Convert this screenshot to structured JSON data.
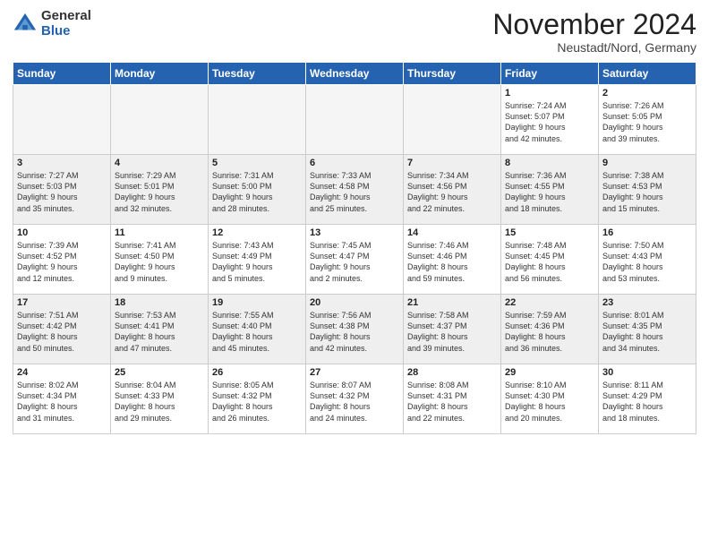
{
  "logo": {
    "general": "General",
    "blue": "Blue"
  },
  "header": {
    "month": "November 2024",
    "location": "Neustadt/Nord, Germany"
  },
  "weekdays": [
    "Sunday",
    "Monday",
    "Tuesday",
    "Wednesday",
    "Thursday",
    "Friday",
    "Saturday"
  ],
  "weeks": [
    [
      {
        "day": "",
        "info": ""
      },
      {
        "day": "",
        "info": ""
      },
      {
        "day": "",
        "info": ""
      },
      {
        "day": "",
        "info": ""
      },
      {
        "day": "",
        "info": ""
      },
      {
        "day": "1",
        "info": "Sunrise: 7:24 AM\nSunset: 5:07 PM\nDaylight: 9 hours\nand 42 minutes."
      },
      {
        "day": "2",
        "info": "Sunrise: 7:26 AM\nSunset: 5:05 PM\nDaylight: 9 hours\nand 39 minutes."
      }
    ],
    [
      {
        "day": "3",
        "info": "Sunrise: 7:27 AM\nSunset: 5:03 PM\nDaylight: 9 hours\nand 35 minutes."
      },
      {
        "day": "4",
        "info": "Sunrise: 7:29 AM\nSunset: 5:01 PM\nDaylight: 9 hours\nand 32 minutes."
      },
      {
        "day": "5",
        "info": "Sunrise: 7:31 AM\nSunset: 5:00 PM\nDaylight: 9 hours\nand 28 minutes."
      },
      {
        "day": "6",
        "info": "Sunrise: 7:33 AM\nSunset: 4:58 PM\nDaylight: 9 hours\nand 25 minutes."
      },
      {
        "day": "7",
        "info": "Sunrise: 7:34 AM\nSunset: 4:56 PM\nDaylight: 9 hours\nand 22 minutes."
      },
      {
        "day": "8",
        "info": "Sunrise: 7:36 AM\nSunset: 4:55 PM\nDaylight: 9 hours\nand 18 minutes."
      },
      {
        "day": "9",
        "info": "Sunrise: 7:38 AM\nSunset: 4:53 PM\nDaylight: 9 hours\nand 15 minutes."
      }
    ],
    [
      {
        "day": "10",
        "info": "Sunrise: 7:39 AM\nSunset: 4:52 PM\nDaylight: 9 hours\nand 12 minutes."
      },
      {
        "day": "11",
        "info": "Sunrise: 7:41 AM\nSunset: 4:50 PM\nDaylight: 9 hours\nand 9 minutes."
      },
      {
        "day": "12",
        "info": "Sunrise: 7:43 AM\nSunset: 4:49 PM\nDaylight: 9 hours\nand 5 minutes."
      },
      {
        "day": "13",
        "info": "Sunrise: 7:45 AM\nSunset: 4:47 PM\nDaylight: 9 hours\nand 2 minutes."
      },
      {
        "day": "14",
        "info": "Sunrise: 7:46 AM\nSunset: 4:46 PM\nDaylight: 8 hours\nand 59 minutes."
      },
      {
        "day": "15",
        "info": "Sunrise: 7:48 AM\nSunset: 4:45 PM\nDaylight: 8 hours\nand 56 minutes."
      },
      {
        "day": "16",
        "info": "Sunrise: 7:50 AM\nSunset: 4:43 PM\nDaylight: 8 hours\nand 53 minutes."
      }
    ],
    [
      {
        "day": "17",
        "info": "Sunrise: 7:51 AM\nSunset: 4:42 PM\nDaylight: 8 hours\nand 50 minutes."
      },
      {
        "day": "18",
        "info": "Sunrise: 7:53 AM\nSunset: 4:41 PM\nDaylight: 8 hours\nand 47 minutes."
      },
      {
        "day": "19",
        "info": "Sunrise: 7:55 AM\nSunset: 4:40 PM\nDaylight: 8 hours\nand 45 minutes."
      },
      {
        "day": "20",
        "info": "Sunrise: 7:56 AM\nSunset: 4:38 PM\nDaylight: 8 hours\nand 42 minutes."
      },
      {
        "day": "21",
        "info": "Sunrise: 7:58 AM\nSunset: 4:37 PM\nDaylight: 8 hours\nand 39 minutes."
      },
      {
        "day": "22",
        "info": "Sunrise: 7:59 AM\nSunset: 4:36 PM\nDaylight: 8 hours\nand 36 minutes."
      },
      {
        "day": "23",
        "info": "Sunrise: 8:01 AM\nSunset: 4:35 PM\nDaylight: 8 hours\nand 34 minutes."
      }
    ],
    [
      {
        "day": "24",
        "info": "Sunrise: 8:02 AM\nSunset: 4:34 PM\nDaylight: 8 hours\nand 31 minutes."
      },
      {
        "day": "25",
        "info": "Sunrise: 8:04 AM\nSunset: 4:33 PM\nDaylight: 8 hours\nand 29 minutes."
      },
      {
        "day": "26",
        "info": "Sunrise: 8:05 AM\nSunset: 4:32 PM\nDaylight: 8 hours\nand 26 minutes."
      },
      {
        "day": "27",
        "info": "Sunrise: 8:07 AM\nSunset: 4:32 PM\nDaylight: 8 hours\nand 24 minutes."
      },
      {
        "day": "28",
        "info": "Sunrise: 8:08 AM\nSunset: 4:31 PM\nDaylight: 8 hours\nand 22 minutes."
      },
      {
        "day": "29",
        "info": "Sunrise: 8:10 AM\nSunset: 4:30 PM\nDaylight: 8 hours\nand 20 minutes."
      },
      {
        "day": "30",
        "info": "Sunrise: 8:11 AM\nSunset: 4:29 PM\nDaylight: 8 hours\nand 18 minutes."
      }
    ]
  ]
}
